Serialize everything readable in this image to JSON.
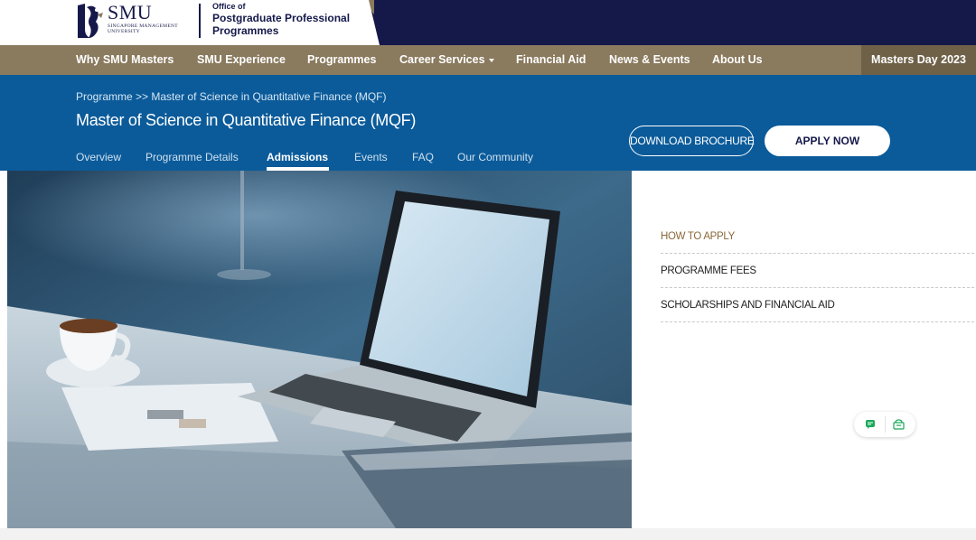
{
  "header": {
    "logo_smu": "SMU",
    "logo_sub_1": "SINGAPORE MANAGEMENT",
    "logo_sub_2": "UNIVERSITY",
    "office_line1": "Office of",
    "office_line2": "Postgraduate Professional",
    "office_line3": "Programmes"
  },
  "main_nav": {
    "items": [
      {
        "label": "Why SMU Masters"
      },
      {
        "label": "SMU Experience"
      },
      {
        "label": "Programmes"
      },
      {
        "label": "Career Services"
      },
      {
        "label": "Financial Aid"
      },
      {
        "label": "News & Events"
      },
      {
        "label": "About Us"
      }
    ],
    "masters_day": "Masters Day 2023"
  },
  "banner": {
    "breadcrumb_root": "Programme",
    "breadcrumb_sep": ">>",
    "breadcrumb_current": "Master of Science in Quantitative Finance (MQF)",
    "title": "Master of Science in Quantitative Finance (MQF)",
    "tabs": [
      {
        "label": "Overview"
      },
      {
        "label": "Programme Details"
      },
      {
        "label": "Admissions"
      },
      {
        "label": "Events"
      },
      {
        "label": "FAQ"
      },
      {
        "label": "Our Community"
      }
    ],
    "download_label": "DOWNLOAD BROCHURE",
    "apply_label": "APPLY NOW"
  },
  "side_menu": {
    "items": [
      {
        "label": "HOW TO APPLY"
      },
      {
        "label": "PROGRAMME FEES"
      },
      {
        "label": "SCHOLARSHIPS AND FINANCIAL AID"
      }
    ]
  },
  "widget": {
    "icons": [
      "chat-icon",
      "mailbox-icon"
    ]
  },
  "colors": {
    "navy": "#15194a",
    "gold": "#8a7a5e",
    "banner_blue": "#0b5b9a",
    "active_link": "#8a6a3a"
  }
}
